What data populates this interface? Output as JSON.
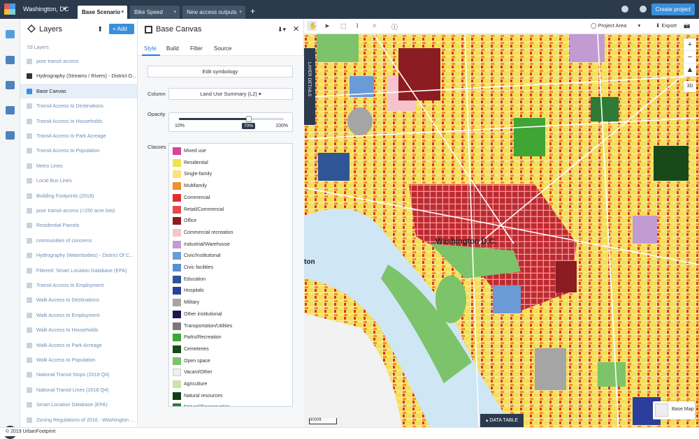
{
  "topbar": {
    "project": "Washington, DC",
    "tabs": [
      {
        "label": "Base Scenario",
        "active": true
      },
      {
        "label": "Bike Speed",
        "active": false
      },
      {
        "label": "New access outputs",
        "active": false
      }
    ],
    "create_label": "Create project",
    "icons": [
      "help-icon",
      "user-icon"
    ]
  },
  "layers": {
    "title": "Layers",
    "add_label": "+ Add",
    "count": "53 Layers",
    "items": [
      {
        "label": "poor transit access",
        "style": "dim"
      },
      {
        "label": "Hydrography (Streams / Rivers) - District O...",
        "style": "dark"
      },
      {
        "label": "Base Canvas",
        "style": "active"
      },
      {
        "label": "Transit Access to Destinations",
        "style": "dim"
      },
      {
        "label": "Transit Access to Households",
        "style": "dim"
      },
      {
        "label": "Transit Access to Park Acreage",
        "style": "dim"
      },
      {
        "label": "Transit Access to Population",
        "style": "dim"
      },
      {
        "label": "Metro Lines",
        "style": "dim"
      },
      {
        "label": "Local Bus Lines",
        "style": "dim"
      },
      {
        "label": "Building Footprints (2018)",
        "style": "dim"
      },
      {
        "label": "poor transit access (<150 acre lots)",
        "style": "dim"
      },
      {
        "label": "Residential Parcels",
        "style": "dim"
      },
      {
        "label": "communities of concerns",
        "style": "dim"
      },
      {
        "label": "Hydrography (Waterbodies) - District Of C...",
        "style": "dim"
      },
      {
        "label": "Filtered: Smart Location Database (EPA)",
        "style": "dim"
      },
      {
        "label": "Transit Access to Employment",
        "style": "dim"
      },
      {
        "label": "Walk Access to Destinations",
        "style": "dim"
      },
      {
        "label": "Walk Access to Employment",
        "style": "dim"
      },
      {
        "label": "Walk Access to Households",
        "style": "dim"
      },
      {
        "label": "Walk Access to Park Acreage",
        "style": "dim"
      },
      {
        "label": "Walk Access to Population",
        "style": "dim"
      },
      {
        "label": "National Transit Stops (2018 Q4)",
        "style": "dim"
      },
      {
        "label": "National Transit Lines (2018 Q4)",
        "style": "dim"
      },
      {
        "label": "Smart Location Database (EPA)",
        "style": "dim"
      },
      {
        "label": "Zoning Regulations of 2016 - Washington ...",
        "style": "dim"
      }
    ]
  },
  "canvas": {
    "title": "Base Canvas",
    "tabs": [
      "Style",
      "Build",
      "Filter",
      "Source"
    ],
    "active_tab": "Style",
    "edit_label": "Edit symbology",
    "column_label": "Column",
    "column_value": "Land Use Summary (L2)",
    "opacity_label": "Opacity",
    "opacity_min": "10%",
    "opacity_max": "100%",
    "opacity_value": "70%",
    "opacity_fraction": 0.7,
    "classes_label": "Classes",
    "classes": [
      {
        "name": "Mixed use",
        "color": "#d6449b"
      },
      {
        "name": "Residential",
        "color": "#f2e14e"
      },
      {
        "name": "Single-family",
        "color": "#f7e47a"
      },
      {
        "name": "Multifamily",
        "color": "#f28e2b"
      },
      {
        "name": "Commercial",
        "color": "#e0302d"
      },
      {
        "name": "Retail/Commercial",
        "color": "#e7484a"
      },
      {
        "name": "Office",
        "color": "#8b1c22"
      },
      {
        "name": "Commercial recreation",
        "color": "#f6c3cc"
      },
      {
        "name": "Industrial/Warehouse",
        "color": "#c39bd3"
      },
      {
        "name": "Civic/Institutional",
        "color": "#6b9bd6"
      },
      {
        "name": "Civic facilities",
        "color": "#5a8fd1"
      },
      {
        "name": "Education",
        "color": "#2f5597"
      },
      {
        "name": "Hospitals",
        "color": "#2c3e9c"
      },
      {
        "name": "Military",
        "color": "#a5a5a5"
      },
      {
        "name": "Other institutional",
        "color": "#1a1a4a"
      },
      {
        "name": "Transportation/Utilities",
        "color": "#7a7a7a"
      },
      {
        "name": "Parks/Recreation",
        "color": "#3fa535"
      },
      {
        "name": "Cemeteries",
        "color": "#174a18"
      },
      {
        "name": "Open space",
        "color": "#7cc36a"
      },
      {
        "name": "Vacant/Other",
        "color": "#efefef"
      },
      {
        "name": "Agriculture",
        "color": "#c9e3a8"
      },
      {
        "name": "Natural resources",
        "color": "#0f3d16"
      },
      {
        "name": "Natural/Conservation",
        "color": "#2f7a35"
      }
    ]
  },
  "map": {
    "layer_details": "LAYER DETAILS",
    "project_area": "Project Area",
    "export": "Export",
    "city_label": "Washington D.C.",
    "city_label2": "ton",
    "scale": "3000ft",
    "data_table": "DATA TABLE",
    "base_map": "Base Map",
    "zoom_3d": "3D"
  },
  "footer": "© 2019 UrbanFootprint"
}
